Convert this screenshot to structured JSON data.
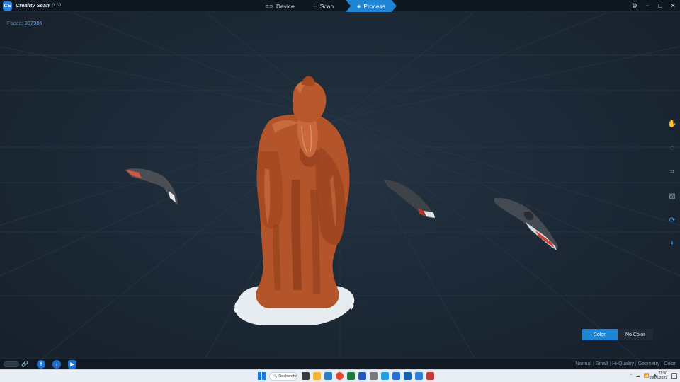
{
  "app": {
    "logo_text": "CS",
    "name": "Creality Scan",
    "version": "1.0.10"
  },
  "tabs": [
    {
      "label": "Device",
      "icon": "link-icon",
      "active": false
    },
    {
      "label": "Scan",
      "icon": "scan-icon",
      "active": false
    },
    {
      "label": "Process",
      "icon": "process-icon",
      "active": true
    }
  ],
  "window_controls": {
    "settings": "⚙",
    "minimize": "−",
    "maximize": "□",
    "close": "✕"
  },
  "viewport": {
    "faces_label": "Faces:",
    "faces_value": "387986"
  },
  "right_toolbar": [
    {
      "name": "pan-tool-icon",
      "glyph": "✋",
      "active": false
    },
    {
      "name": "lasso-select-icon",
      "glyph": "◌",
      "active": false
    },
    {
      "name": "crop-icon",
      "glyph": "⌗",
      "active": false
    },
    {
      "name": "texture-icon",
      "glyph": "▨",
      "active": false
    },
    {
      "name": "process-refresh-icon",
      "glyph": "⟳",
      "active": true
    },
    {
      "name": "export-download-icon",
      "glyph": "⭳",
      "active": true
    }
  ],
  "color_toggle": {
    "color_label": "Color",
    "no_color_label": "No Color",
    "selected": "Color"
  },
  "statusbar": {
    "link_glyph": "🔗",
    "social": [
      {
        "name": "facebook-icon",
        "glyph": "f"
      },
      {
        "name": "download-icon",
        "glyph": "↓"
      },
      {
        "name": "youtube-icon",
        "glyph": "▶"
      }
    ],
    "render_modes": [
      "Normal",
      "Small",
      "Hi-Quality",
      "Geometry",
      "Color"
    ]
  },
  "taskbar": {
    "search_label": "Recherche",
    "search_icon": "🔍",
    "tray_glyphs": [
      "^",
      "☁",
      "📶",
      "🔊"
    ],
    "time": "21:50",
    "date": "28/05/2023"
  },
  "colors": {
    "accent": "#1f86d6",
    "statue": "#b4542a",
    "statue_dark": "#7a2f12",
    "base": "#e8eef2"
  }
}
